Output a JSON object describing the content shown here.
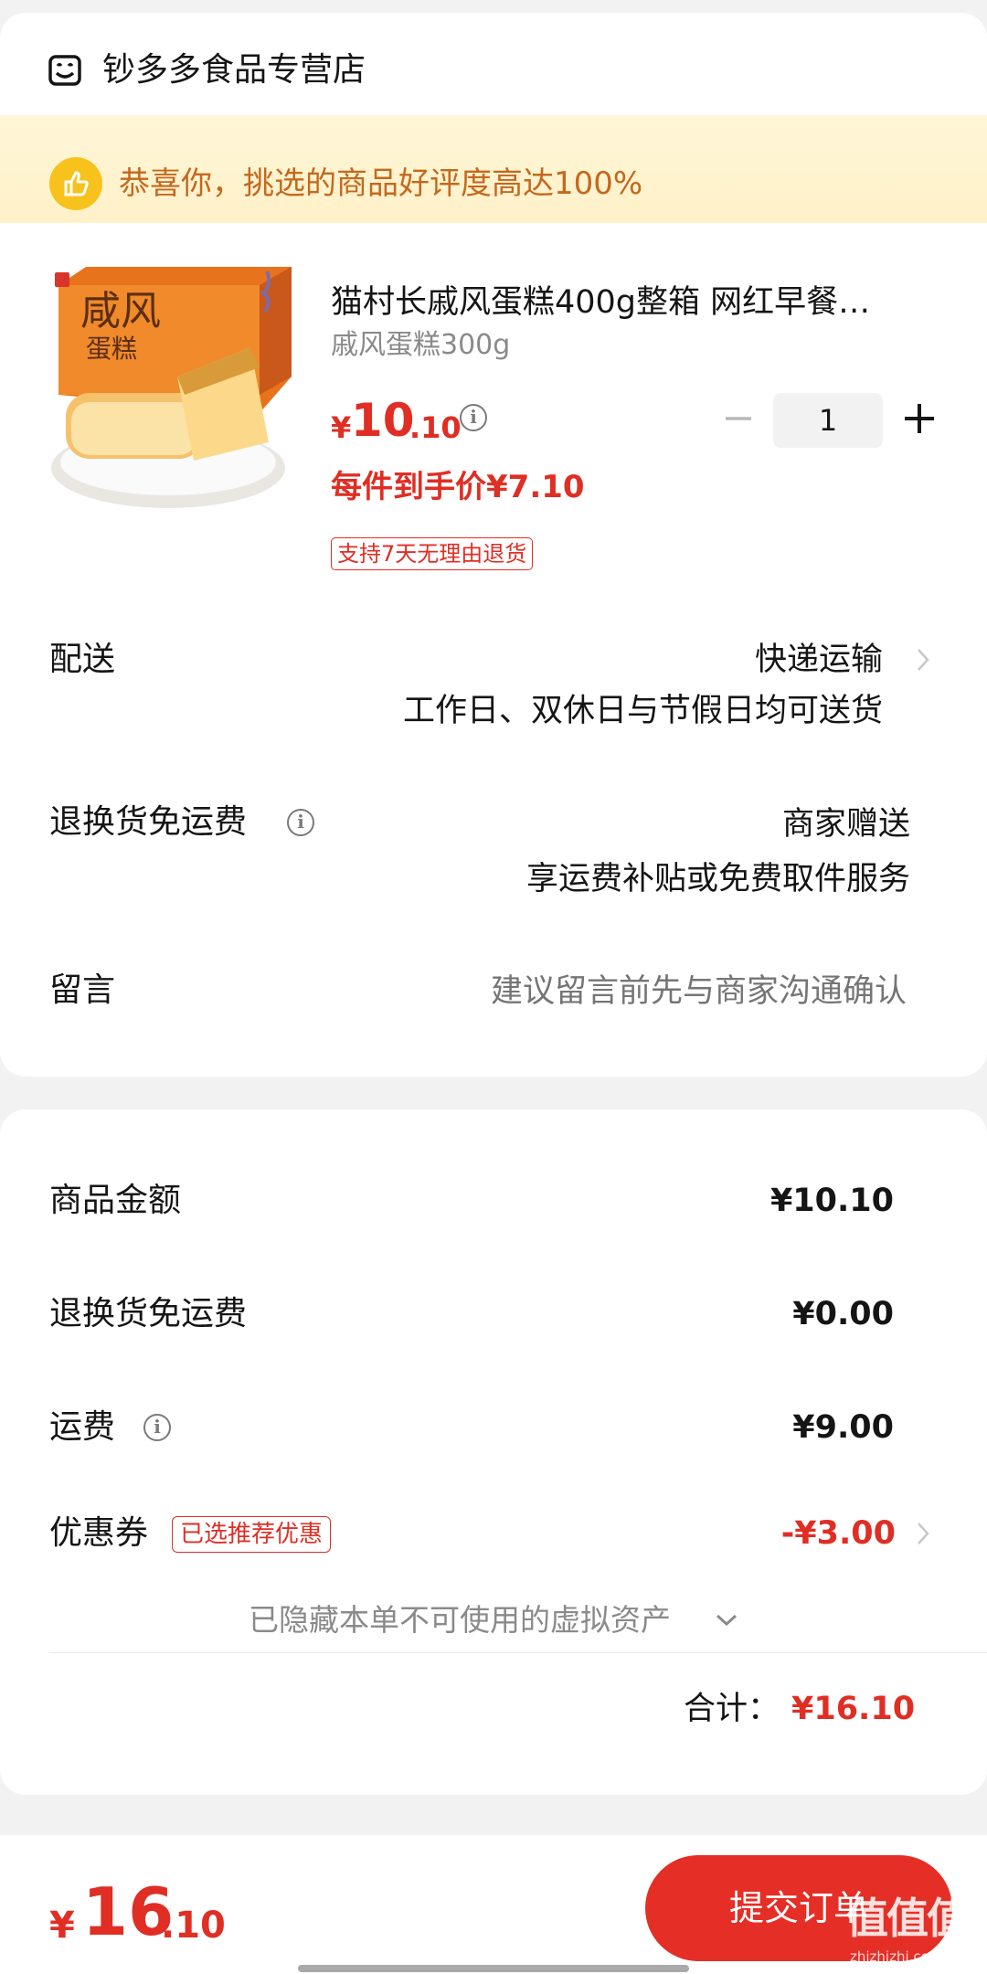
{
  "store": {
    "name": "钞多多食品专营店",
    "icon": "store-icon"
  },
  "banner": {
    "text": "恭喜你，挑选的商品好评度高达100%",
    "icon": "thumbs-up-icon"
  },
  "product": {
    "image_text": [
      "咸风",
      "蛋糕"
    ],
    "title": "猫村长戚风蛋糕400g整箱 网红早餐…",
    "spec": "戚风蛋糕300g",
    "price_yen": "¥",
    "price_int": "10",
    "price_dec": ".10",
    "unit_price": "每件到手价¥7.10",
    "return_tag": "支持7天无理由退货",
    "quantity": "1"
  },
  "delivery": {
    "label": "配送",
    "method": "快递运输",
    "note": "工作日、双休日与节假日均可送货"
  },
  "return_shipping": {
    "label": "退换货免运费",
    "value": "商家赠送",
    "note": "享运费补贴或免费取件服务"
  },
  "message": {
    "label": "留言",
    "placeholder": "建议留言前先与商家沟通确认"
  },
  "summary": {
    "goods_label": "商品金额",
    "goods_value": "¥10.10",
    "return_label": "退换货免运费",
    "return_value": "¥0.00",
    "shipping_label": "运费",
    "shipping_value": "¥9.00",
    "coupon_label": "优惠券",
    "coupon_tag": "已选推荐优惠",
    "coupon_value": "-¥3.00",
    "hidden_assets": "已隐藏本单不可使用的虚拟资产",
    "total_label": "合计：",
    "total_value": "¥16.10"
  },
  "bottom": {
    "price_yen": "¥",
    "price_int": "16",
    "price_dec": ".10",
    "submit_label": "提交订单",
    "watermark": "值值值",
    "watermark_sub": "zhizhizhi.com"
  },
  "colors": {
    "accent": "#e02e24",
    "banner_bg": "#fff4d2",
    "banner_text": "#c4681e",
    "thumb": "#f7c21b"
  }
}
